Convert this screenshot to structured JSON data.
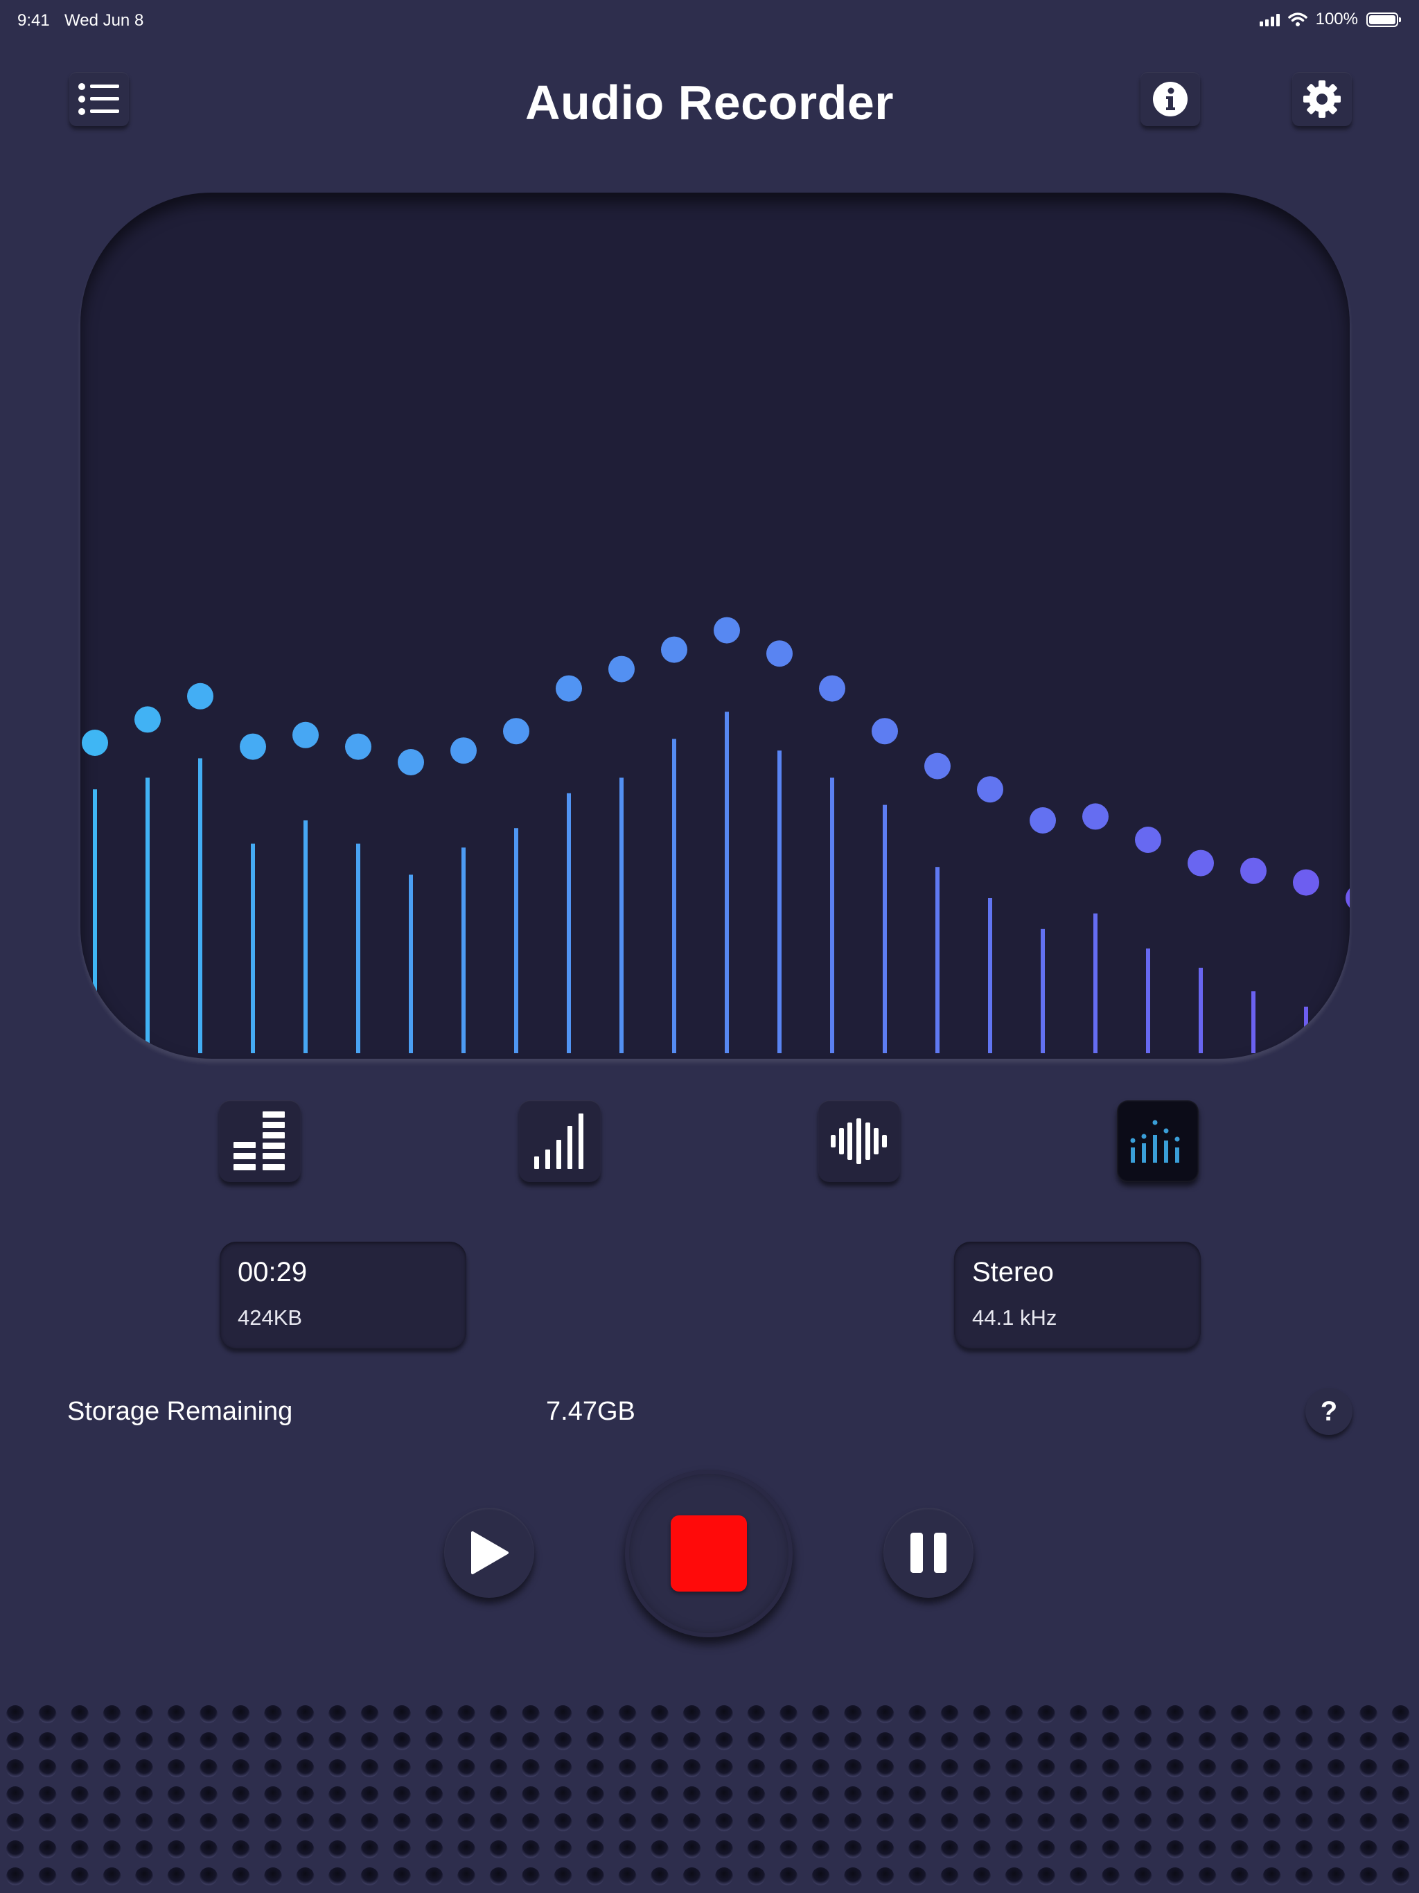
{
  "status_bar": {
    "time": "9:41",
    "date": "Wed Jun 8",
    "battery": "100%"
  },
  "header": {
    "title": "Audio Recorder",
    "menu_icon": "list-icon",
    "info_icon": "info-icon",
    "settings_icon": "gear-icon"
  },
  "visualizer": {
    "levels": [
      0.68,
      0.71,
      0.76,
      0.54,
      0.6,
      0.54,
      0.46,
      0.53,
      0.58,
      0.67,
      0.71,
      0.81,
      0.88,
      0.78,
      0.71,
      0.64,
      0.48,
      0.4,
      0.32,
      0.36,
      0.27,
      0.22,
      0.16,
      0.12
    ],
    "peaks": [
      0.8,
      0.86,
      0.92,
      0.79,
      0.82,
      0.79,
      0.75,
      0.78,
      0.83,
      0.94,
      0.99,
      1.04,
      1.09,
      1.03,
      0.94,
      0.83,
      0.74,
      0.68,
      0.6,
      0.61,
      0.55,
      0.49,
      0.47,
      0.44,
      0.4
    ],
    "color_start": "#3fb6f4",
    "color_end": "#6f5af0"
  },
  "modes": [
    {
      "name": "mode-led-bars",
      "icon": "led-bars-icon",
      "active": false
    },
    {
      "name": "mode-ascending-bars",
      "icon": "signal-bars-icon",
      "active": false
    },
    {
      "name": "mode-waveform",
      "icon": "waveform-icon",
      "active": false
    },
    {
      "name": "mode-dots-spectrum",
      "icon": "dot-spectrum-icon",
      "active": true
    }
  ],
  "recording_info": {
    "duration": "00:29",
    "size": "424KB"
  },
  "format_info": {
    "channels": "Stereo",
    "sample_rate": "44.1 kHz"
  },
  "storage": {
    "label": "Storage Remaining",
    "value": "7.47GB",
    "help": "?"
  },
  "controls": {
    "play_icon": "play-icon",
    "stop_icon": "stop-icon",
    "pause_icon": "pause-icon",
    "stop_color": "#ff0a0a"
  }
}
